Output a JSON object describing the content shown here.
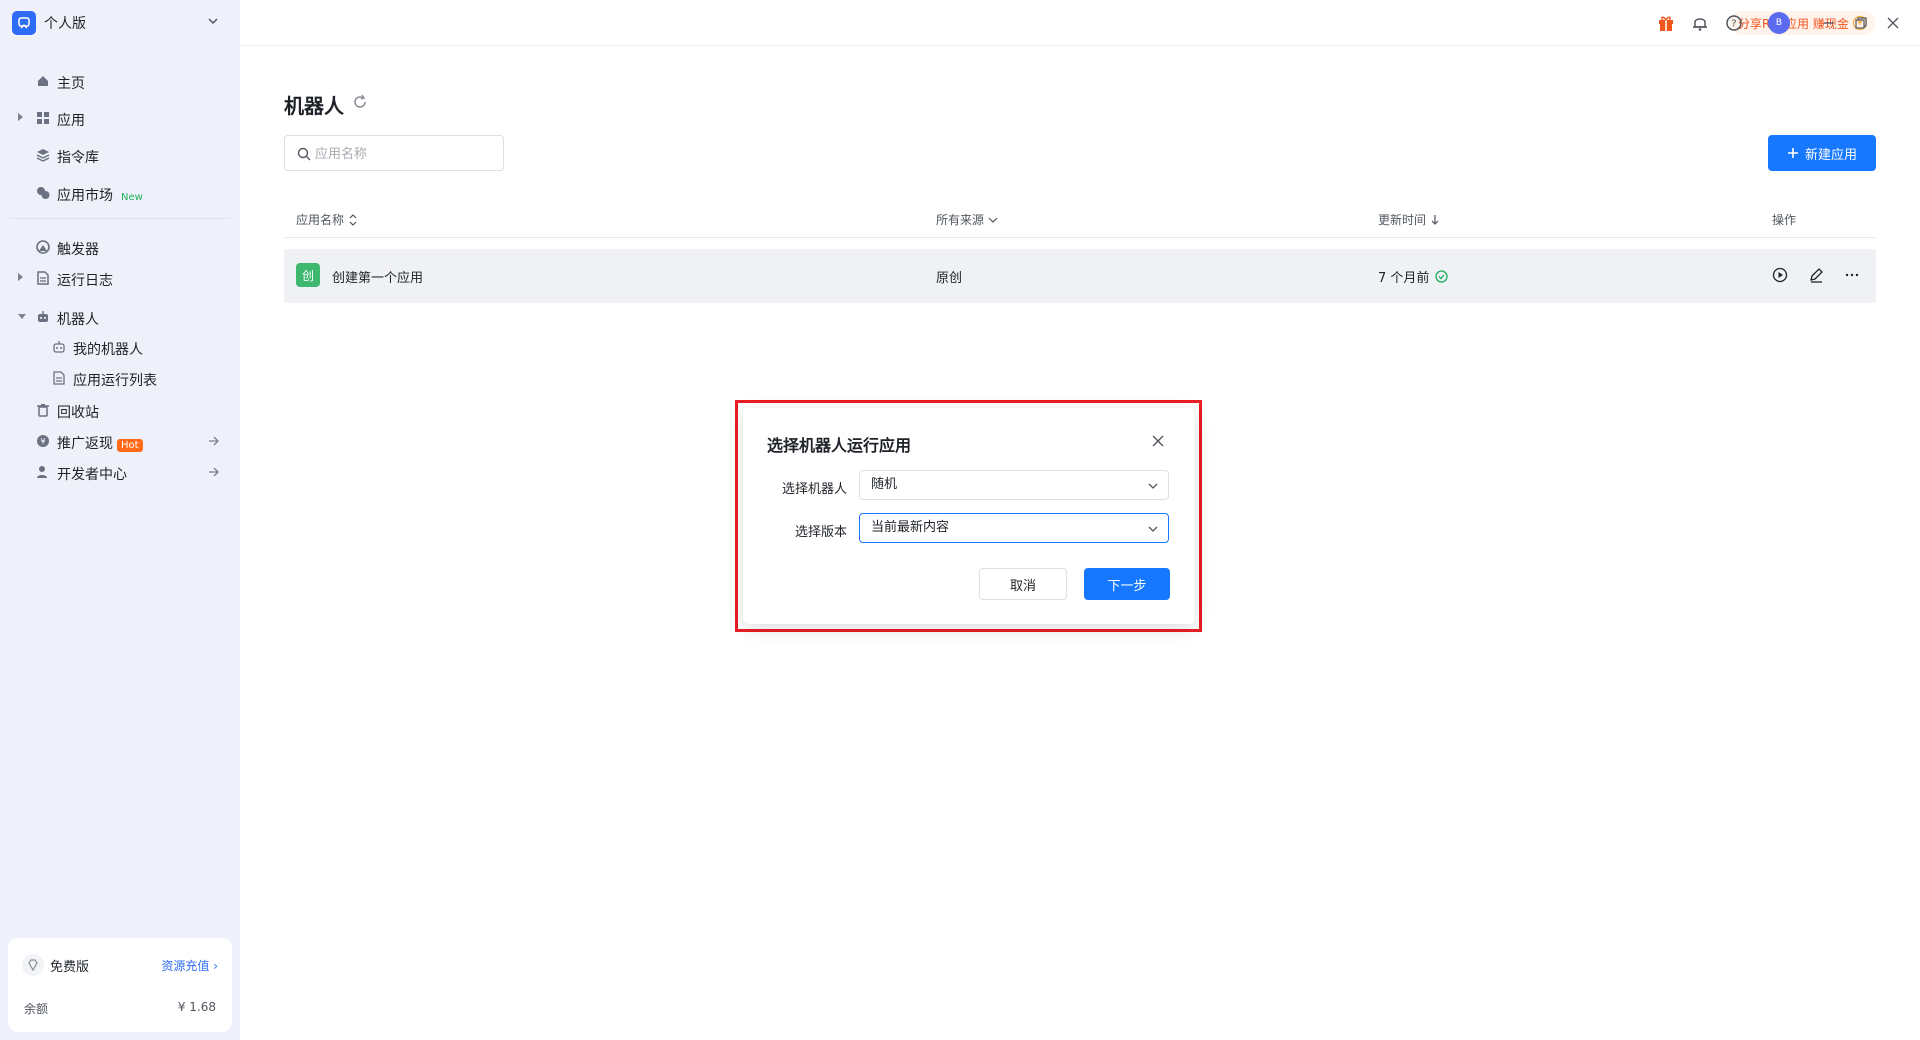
{
  "sidebar": {
    "workspace": "个人版",
    "items": [
      {
        "label": "主页"
      },
      {
        "label": "应用"
      },
      {
        "label": "指令库"
      },
      {
        "label": "应用市场",
        "badge": "New"
      },
      {
        "label": "触发器"
      },
      {
        "label": "运行日志"
      },
      {
        "label": "机器人"
      },
      {
        "label": "我的机器人"
      },
      {
        "label": "应用运行列表"
      },
      {
        "label": "回收站"
      },
      {
        "label": "推广返现",
        "badge": "Hot"
      },
      {
        "label": "开发者中心"
      }
    ],
    "plan": {
      "name": "免费版",
      "recharge_link": "资源充值 ›",
      "balance_label": "余额",
      "balance_value": "¥ 1.68"
    }
  },
  "topbar": {
    "promo": "分享RPA应用 赚现金",
    "promo_coin": "¥",
    "avatar_letter": "B"
  },
  "main": {
    "title": "机器人",
    "search_placeholder": "应用名称",
    "new_button": "新建应用",
    "table": {
      "headers": {
        "name": "应用名称",
        "source": "所有来源",
        "updated": "更新时间",
        "actions": "操作"
      },
      "rows": [
        {
          "icon_char": "创",
          "name": "创建第一个应用",
          "source": "原创",
          "updated": "7 个月前"
        }
      ]
    }
  },
  "dialog": {
    "title": "选择机器人运行应用",
    "robot_label": "选择机器人",
    "robot_value": "随机",
    "version_label": "选择版本",
    "version_value": "当前最新内容",
    "cancel": "取消",
    "next": "下一步"
  },
  "colors": {
    "primary": "#1677ff",
    "highlight": "#e81d25",
    "sidebar_bg": "#eef1f9",
    "hot": "#ff6a1a",
    "new": "#20b05c"
  }
}
